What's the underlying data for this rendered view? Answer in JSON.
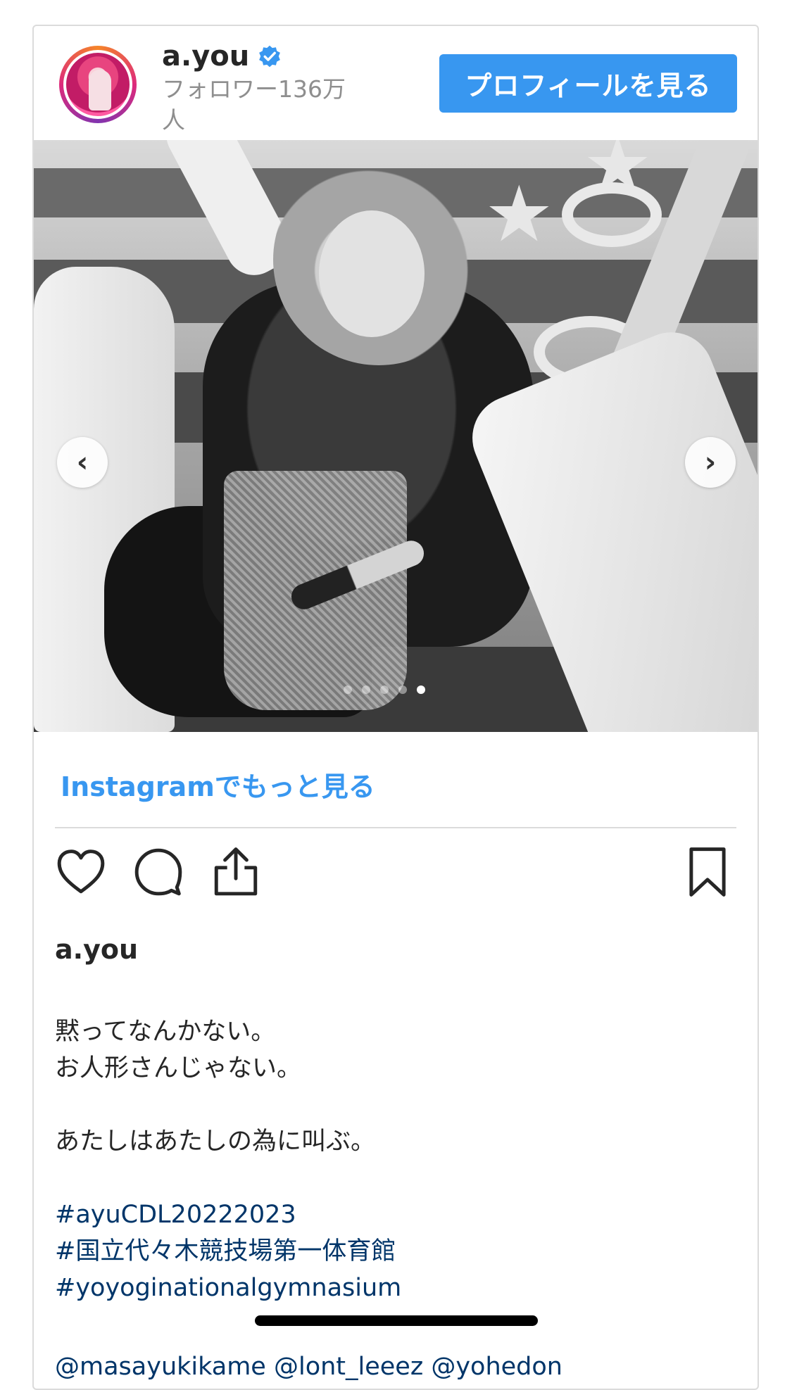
{
  "header": {
    "username": "a.you",
    "followers": "フォロワー136万人",
    "profile_button": "プロフィールを見る"
  },
  "carousel": {
    "slide_count": 5,
    "active_slide": 5
  },
  "more_link": "Instagramでもっと見る",
  "actions": {
    "icons": [
      "heart-icon",
      "comment-icon",
      "share-icon",
      "bookmark-icon"
    ]
  },
  "caption": {
    "username": "a.you",
    "lines": [
      "黙ってなんかない。",
      "お人形さんじゃない。",
      "",
      "あたしはあたしの為に叫ぶ。",
      "",
      "#ayuCDL20222023",
      "#国立代々木競技場第一体育館",
      "#yoyoginationalgymnasium"
    ],
    "mentions": "@masayukikame @lont_leeez @yohedon"
  },
  "colors": {
    "accent": "#3897f0",
    "hashtag": "#003569",
    "border": "#dbdbdb",
    "secondary_text": "#8e8e8e"
  }
}
